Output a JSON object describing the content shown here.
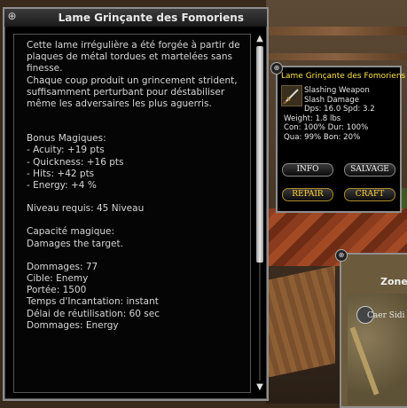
{
  "description_window": {
    "title": "Lame Grinçante des Fomoriens",
    "system_icon": "⊕",
    "paragraphs": [
      "Cette lame irrégulière a été forgée à partir de plaques de métal tordues et martelées sans finesse.",
      "Chaque coup produit un grincement strident, suffisamment perturbant pour déstabiliser même les adversaires les plus aguerris."
    ],
    "bonus_header": "Bonus Magiques:",
    "bonuses": [
      "- Acuity: +19 pts",
      "- Quickness: +16 pts",
      "- Hits: +42 pts",
      "- Energy: +4 %"
    ],
    "level_req": "Niveau requis: 45 Niveau",
    "ability_header": "Capacité magique:",
    "ability_text": "Damages the target.",
    "spell_lines": [
      "Dommages: 77",
      "Cible: Enemy",
      "Portée: 1500",
      "Temps d'Incantation: instant",
      "Délai de réutilisation: 60 sec",
      "Dommages: Energy"
    ],
    "scroll": {
      "up_icon": "▲",
      "down_icon": "▼",
      "position": 0.0
    }
  },
  "item_window": {
    "name": "Lame Grinçante des Fomoriens",
    "type_line1": "Slashing Weapon",
    "type_line2": "Slash Damage",
    "dps_spd": "Dps: 16.0  Spd: 3.2",
    "weight": "Weight: 1.8 lbs",
    "con_dur": "Con: 100%  Dur: 100%",
    "qua_bon": "Qua: 99%  Bon: 20%",
    "buttons": {
      "info": "INFO",
      "salvage": "SALVAGE",
      "repair": "REPAIR",
      "craft": "CRAFT"
    },
    "name_color": "#ffe34d",
    "gold_color": "#ffcc33"
  },
  "zone_window": {
    "title": "Zone",
    "place": "Caer Sidi"
  }
}
